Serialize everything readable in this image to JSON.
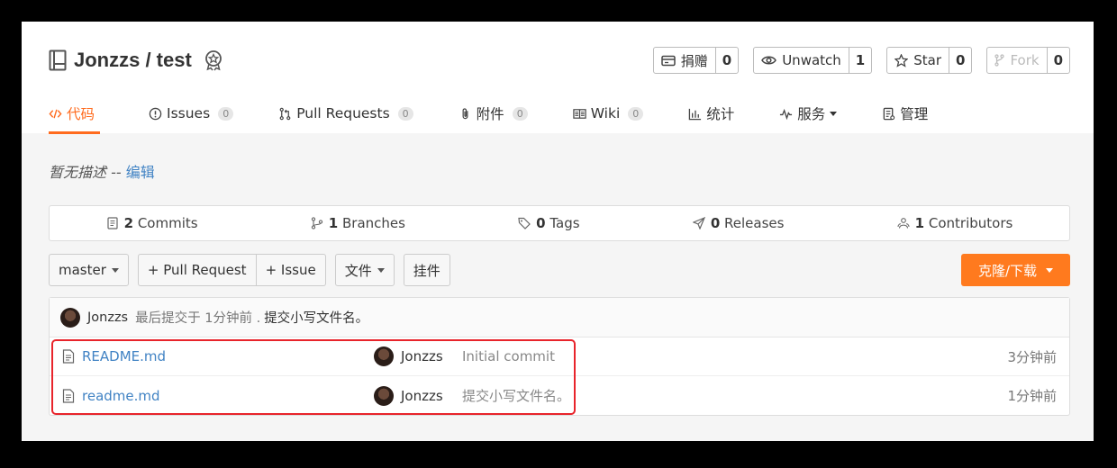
{
  "repo": {
    "title": "Jonzzs / test"
  },
  "actions": [
    {
      "label": "捐赠",
      "count": "0",
      "icon": "donate-icon",
      "disabled": false
    },
    {
      "label": "Unwatch",
      "count": "1",
      "icon": "eye-icon",
      "disabled": false
    },
    {
      "label": "Star",
      "count": "0",
      "icon": "star-icon",
      "disabled": false
    },
    {
      "label": "Fork",
      "count": "0",
      "icon": "fork-icon",
      "disabled": true
    }
  ],
  "tabs": [
    {
      "label": "代码",
      "icon": "code-icon",
      "active": true
    },
    {
      "label": "Issues",
      "count": "0",
      "icon": "issue-icon"
    },
    {
      "label": "Pull Requests",
      "count": "0",
      "icon": "pull-request-icon"
    },
    {
      "label": "附件",
      "count": "0",
      "icon": "attachment-icon"
    },
    {
      "label": "Wiki",
      "count": "0",
      "icon": "wiki-icon"
    },
    {
      "label": "统计",
      "icon": "stats-icon"
    },
    {
      "label": "服务",
      "icon": "pulse-icon",
      "dropdown": true
    },
    {
      "label": "管理",
      "icon": "settings-icon"
    }
  ],
  "description": {
    "text": "暂无描述 -- ",
    "edit": "编辑"
  },
  "stats": [
    {
      "num": "2",
      "label": " Commits",
      "icon": "commit-icon"
    },
    {
      "num": "1",
      "label": " Branches",
      "icon": "branch-icon"
    },
    {
      "num": "0",
      "label": " Tags",
      "icon": "tag-icon"
    },
    {
      "num": "0",
      "label": " Releases",
      "icon": "release-icon"
    },
    {
      "num": "1",
      "label": " Contributors",
      "icon": "contributors-icon"
    }
  ],
  "toolbar": {
    "branch": "master",
    "new_pr": "+ Pull Request",
    "new_issue": "+ Issue",
    "file": "文件",
    "widget": "挂件",
    "clone": "克隆/下载"
  },
  "last_commit": {
    "author": "Jonzzs",
    "text": "最后提交于 1分钟前 .",
    "message": "提交小写文件名。"
  },
  "files": [
    {
      "name": "README.md",
      "author": "Jonzzs",
      "message": "Initial commit",
      "time": "3分钟前"
    },
    {
      "name": "readme.md",
      "author": "Jonzzs",
      "message": "提交小写文件名。",
      "time": "1分钟前"
    }
  ],
  "colors": {
    "accent": "#ff6b1e",
    "link": "#4183c4",
    "highlight": "#e8242b"
  }
}
